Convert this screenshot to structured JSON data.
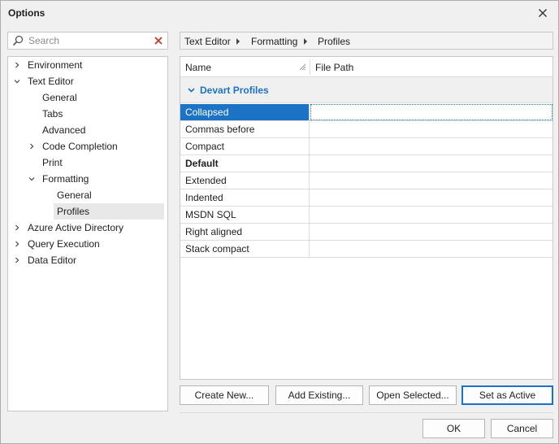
{
  "window": {
    "title": "Options"
  },
  "search": {
    "placeholder": "Search",
    "value": ""
  },
  "tree": [
    {
      "label": "Environment",
      "expandable": true,
      "expanded": false
    },
    {
      "label": "Text Editor",
      "expandable": true,
      "expanded": true
    },
    {
      "label": "General",
      "expandable": false
    },
    {
      "label": "Tabs",
      "expandable": false
    },
    {
      "label": "Advanced",
      "expandable": false
    },
    {
      "label": "Code Completion",
      "expandable": true,
      "expanded": false
    },
    {
      "label": "Print",
      "expandable": false
    },
    {
      "label": "Formatting",
      "expandable": true,
      "expanded": true
    },
    {
      "label": "General",
      "expandable": false
    },
    {
      "label": "Profiles",
      "expandable": false,
      "selected": true
    },
    {
      "label": "Azure Active Directory",
      "expandable": true,
      "expanded": false
    },
    {
      "label": "Query Execution",
      "expandable": true,
      "expanded": false
    },
    {
      "label": "Data Editor",
      "expandable": true,
      "expanded": false
    }
  ],
  "breadcrumb": [
    "Text Editor",
    "Formatting",
    "Profiles"
  ],
  "grid": {
    "columns": {
      "name": "Name",
      "path": "File Path"
    },
    "group": "Devart Profiles",
    "rows": [
      {
        "name": "Collapsed",
        "path": "",
        "selected": true
      },
      {
        "name": "Commas before",
        "path": ""
      },
      {
        "name": "Compact",
        "path": ""
      },
      {
        "name": "Default",
        "path": "",
        "bold": true
      },
      {
        "name": "Extended",
        "path": ""
      },
      {
        "name": "Indented",
        "path": ""
      },
      {
        "name": "MSDN SQL",
        "path": ""
      },
      {
        "name": "Right aligned",
        "path": ""
      },
      {
        "name": "Stack compact",
        "path": ""
      }
    ]
  },
  "actions": {
    "create_new": "Create New...",
    "add_existing": "Add Existing...",
    "open_selected": "Open Selected...",
    "set_as_active": "Set as Active"
  },
  "dialog": {
    "ok": "OK",
    "cancel": "Cancel"
  },
  "icons": {
    "close": "close-icon",
    "search": "search-icon",
    "clear": "clear-icon",
    "chevron_right": "chevron-right-icon",
    "chevron_down": "chevron-down-icon",
    "sort": "sort-icon"
  },
  "colors": {
    "accent": "#1c73c5",
    "clear_x": "#c0392b"
  }
}
